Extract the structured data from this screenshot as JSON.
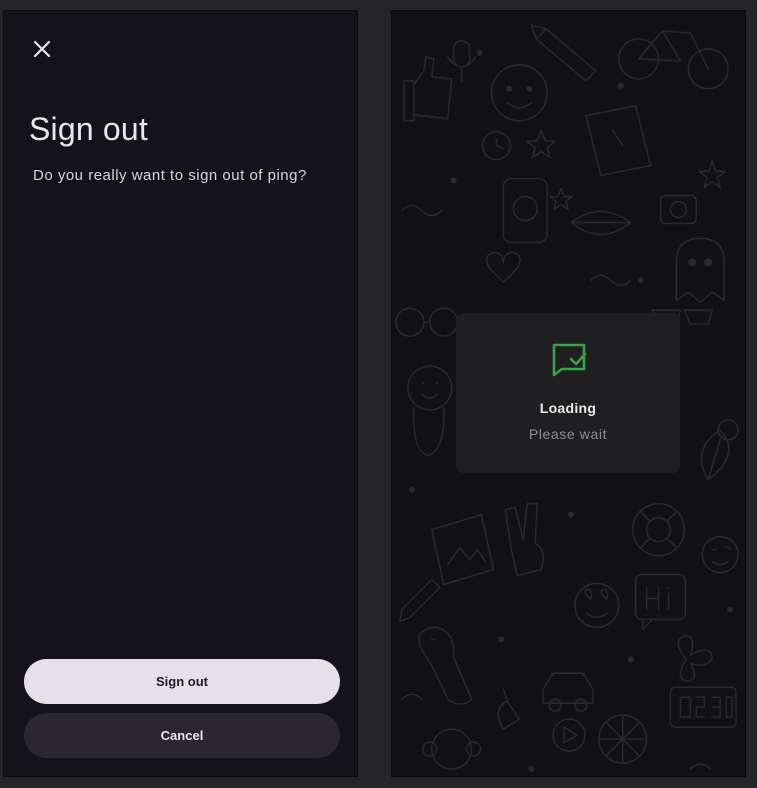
{
  "signout_screen": {
    "close_icon": "close-icon",
    "title": "Sign out",
    "message": "Do you really want to sign out of ping?",
    "primary_button": "Sign out",
    "secondary_button": "Cancel"
  },
  "loading_screen": {
    "icon": "message-check-icon",
    "title": "Loading",
    "subtitle": "Please wait",
    "accent_color": "#3aa14a",
    "background_pattern": "doodle-pattern"
  }
}
